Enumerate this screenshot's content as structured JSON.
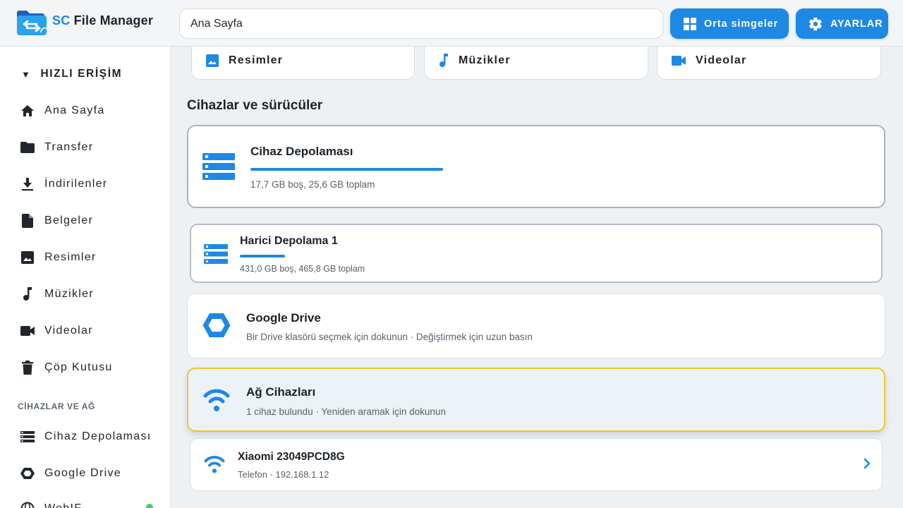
{
  "app": {
    "title_prefix": "SC",
    "title_rest": " File Manager"
  },
  "address_bar": {
    "value": "Ana Sayfa"
  },
  "toolbar": {
    "view_label": "Orta simgeler",
    "settings_label": "AYARLAR"
  },
  "sidebar": {
    "quick_access_caret": "▼",
    "quick_access_label": "HIZLI ERİŞİM",
    "items": [
      {
        "label": "Ana Sayfa",
        "icon": "home-icon"
      },
      {
        "label": "Transfer",
        "icon": "folder-icon"
      },
      {
        "label": "İndirilenler",
        "icon": "download-icon"
      },
      {
        "label": "Belgeler",
        "icon": "document-icon"
      },
      {
        "label": "Resimler",
        "icon": "image-icon"
      },
      {
        "label": "Müzikler",
        "icon": "music-icon"
      },
      {
        "label": "Videolar",
        "icon": "video-icon"
      },
      {
        "label": "Çöp Kutusu",
        "icon": "trash-icon"
      }
    ],
    "devices_section_label": "CİHAZLAR VE AĞ",
    "device_items": [
      {
        "label": "Cihaz Depolaması",
        "icon": "storage-icon"
      },
      {
        "label": "Google Drive",
        "icon": "drive-icon"
      },
      {
        "label": "WebIF",
        "icon": "globe-icon"
      }
    ]
  },
  "main": {
    "quick_cards": [
      {
        "label": "Resimler",
        "icon": "image-icon"
      },
      {
        "label": "Müzikler",
        "icon": "music-icon"
      },
      {
        "label": "Videolar",
        "icon": "video-icon"
      }
    ],
    "section_title": "Cihazlar ve sürücüler",
    "device_storage": {
      "title": "Cihaz Depolaması",
      "subtitle": "17,7 GB boş, 25,6 GB toplam",
      "used_fraction": 0.31
    },
    "external_storage": {
      "title": "Harici Depolama 1",
      "subtitle": "431,0 GB boş, 465,8 GB toplam",
      "used_fraction": 0.08
    },
    "google_drive": {
      "title": "Google Drive",
      "subtitle": "Bir Drive klasörü seçmek için dokunun · Değiştirmek için uzun basın"
    },
    "network": {
      "title": "Ağ Cihazları",
      "subtitle": "1 cihaz bulundu · Yeniden aramak için dokunun"
    },
    "network_device": {
      "title": "Xiaomi 23049PCD8G",
      "subtitle": "Telefon · 192.168.1.12"
    }
  },
  "colors": {
    "accent": "#1e88e5",
    "focus_border": "#e8cc2b",
    "status_dot": "#3ecf6c"
  }
}
